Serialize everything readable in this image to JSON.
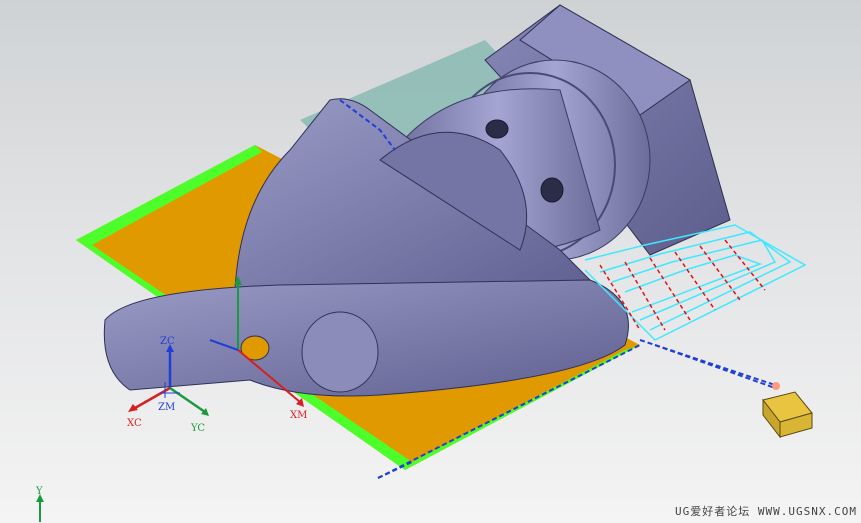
{
  "viewport": {
    "background_top": "#cfd2d4",
    "background_bottom": "#f4f4f4",
    "part_color": "#7b7ca8",
    "blank_color": "#e09a00",
    "toolpath_green": "#4cff2a",
    "toolpath_cyan": "#3fe8ff",
    "toolpath_blue": "#1f3fd6",
    "engage_red": "#e01010",
    "tool_color": "#e8c440"
  },
  "wcs": {
    "xc_label": "XC",
    "yc_label": "YC",
    "zc_label": "ZC",
    "zm_label": "ZM"
  },
  "mcs": {
    "xm_label": "XM"
  },
  "view_triad": {
    "y_label": "Y"
  },
  "watermark": {
    "text": "UG爱好者论坛 WWW.UGSNX.COM"
  }
}
